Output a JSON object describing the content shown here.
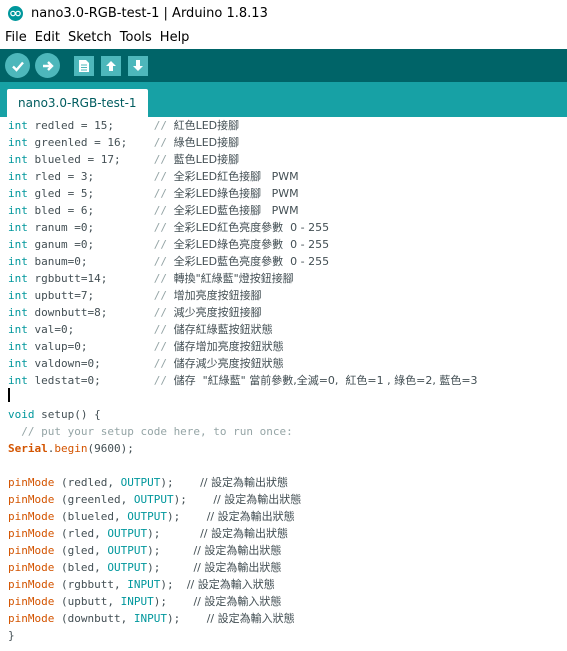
{
  "window": {
    "title": "nano3.0-RGB-test-1 | Arduino 1.8.13"
  },
  "menu": [
    "File",
    "Edit",
    "Sketch",
    "Tools",
    "Help"
  ],
  "toolbar": {
    "icons": [
      "verify-icon",
      "upload-icon",
      "new-icon",
      "open-icon",
      "save-icon"
    ]
  },
  "colors": {
    "toolbar": "#006468",
    "tabbar": "#17a1a5",
    "keyword": "#00979c",
    "function": "#d35400",
    "comment": "#95a5a6"
  },
  "tab": {
    "label": "nano3.0-RGB-test-1"
  },
  "code": [
    {
      "t": "int",
      "r": " redled = 15;      ",
      "c": "// ",
      "z": "紅色LED接腳"
    },
    {
      "t": "int",
      "r": " greenled = 16;    ",
      "c": "// ",
      "z": "綠色LED接腳"
    },
    {
      "t": "int",
      "r": " blueled = 17;     ",
      "c": "// ",
      "z": "藍色LED接腳"
    },
    {
      "t": "int",
      "r": " rled = 3;         ",
      "c": "// ",
      "z": "全彩LED紅色接腳   PWM"
    },
    {
      "t": "int",
      "r": " gled = 5;         ",
      "c": "// ",
      "z": "全彩LED綠色接腳   PWM"
    },
    {
      "t": "int",
      "r": " bled = 6;         ",
      "c": "// ",
      "z": "全彩LED藍色接腳   PWM"
    },
    {
      "t": "int",
      "r": " ranum =0;         ",
      "c": "// ",
      "z": "全彩LED紅色亮度參數  0 - 255"
    },
    {
      "t": "int",
      "r": " ganum =0;         ",
      "c": "// ",
      "z": "全彩LED綠色亮度參數  0 - 255"
    },
    {
      "t": "int",
      "r": " banum=0;          ",
      "c": "// ",
      "z": "全彩LED藍色亮度參數  0 - 255"
    },
    {
      "t": "int",
      "r": " rgbbutt=14;       ",
      "c": "// ",
      "z": "轉換\"紅綠藍\"燈按鈕接腳"
    },
    {
      "t": "int",
      "r": " upbutt=7;         ",
      "c": "// ",
      "z": "增加亮度按鈕接腳"
    },
    {
      "t": "int",
      "r": " downbutt=8;       ",
      "c": "// ",
      "z": "減少亮度按鈕接腳"
    },
    {
      "t": "int",
      "r": " val=0;            ",
      "c": "// ",
      "z": "儲存紅綠藍按鈕狀態"
    },
    {
      "t": "int",
      "r": " valup=0;          ",
      "c": "// ",
      "z": "儲存增加亮度按鈕狀態"
    },
    {
      "t": "int",
      "r": " valdown=0;        ",
      "c": "// ",
      "z": "儲存減少亮度按鈕狀態"
    },
    {
      "t": "int",
      "r": " ledstat=0;        ",
      "c": "// ",
      "z": "儲存  \"紅綠藍\" 當前參數,全滅=0,  紅色=1 , 綠色=2, 藍色=3"
    }
  ],
  "setup": {
    "void": "void",
    "sig": " setup() {",
    "comment": "  // put your setup code here, to run once:",
    "serial_fn": "Serial",
    "serial_dot": ".",
    "serial_begin": "begin",
    "serial_args": "(9600);"
  },
  "pinmodes": [
    {
      "fn": "pinMode",
      "a": " (redled, ",
      "m": "OUTPUT",
      "e": ");",
      "sp": "    ",
      "z": "// 設定為輸出狀態"
    },
    {
      "fn": "pinMode",
      "a": " (greenled, ",
      "m": "OUTPUT",
      "e": ");",
      "sp": "    ",
      "z": "// 設定為輸出狀態"
    },
    {
      "fn": "pinMode",
      "a": " (blueled, ",
      "m": "OUTPUT",
      "e": ");",
      "sp": "    ",
      "z": "// 設定為輸出狀態"
    },
    {
      "fn": "pinMode",
      "a": " (rled, ",
      "m": "OUTPUT",
      "e": ");",
      "sp": "      ",
      "z": "// 設定為輸出狀態"
    },
    {
      "fn": "pinMode",
      "a": " (gled, ",
      "m": "OUTPUT",
      "e": ");",
      "sp": "     ",
      "z": "// 設定為輸出狀態"
    },
    {
      "fn": "pinMode",
      "a": " (bled, ",
      "m": "OUTPUT",
      "e": ");",
      "sp": "     ",
      "z": "// 設定為輸出狀態"
    },
    {
      "fn": "pinMode",
      "a": " (rgbbutt, ",
      "m": "INPUT",
      "e": ");",
      "sp": "  ",
      "z": "// 設定為輸入狀態"
    },
    {
      "fn": "pinMode",
      "a": " (upbutt, ",
      "m": "INPUT",
      "e": ");",
      "sp": "    ",
      "z": "// 設定為輸入狀態"
    },
    {
      "fn": "pinMode",
      "a": " (downbutt, ",
      "m": "INPUT",
      "e": ");",
      "sp": "    ",
      "z": "// 設定為輸入狀態"
    }
  ],
  "closing": "}"
}
